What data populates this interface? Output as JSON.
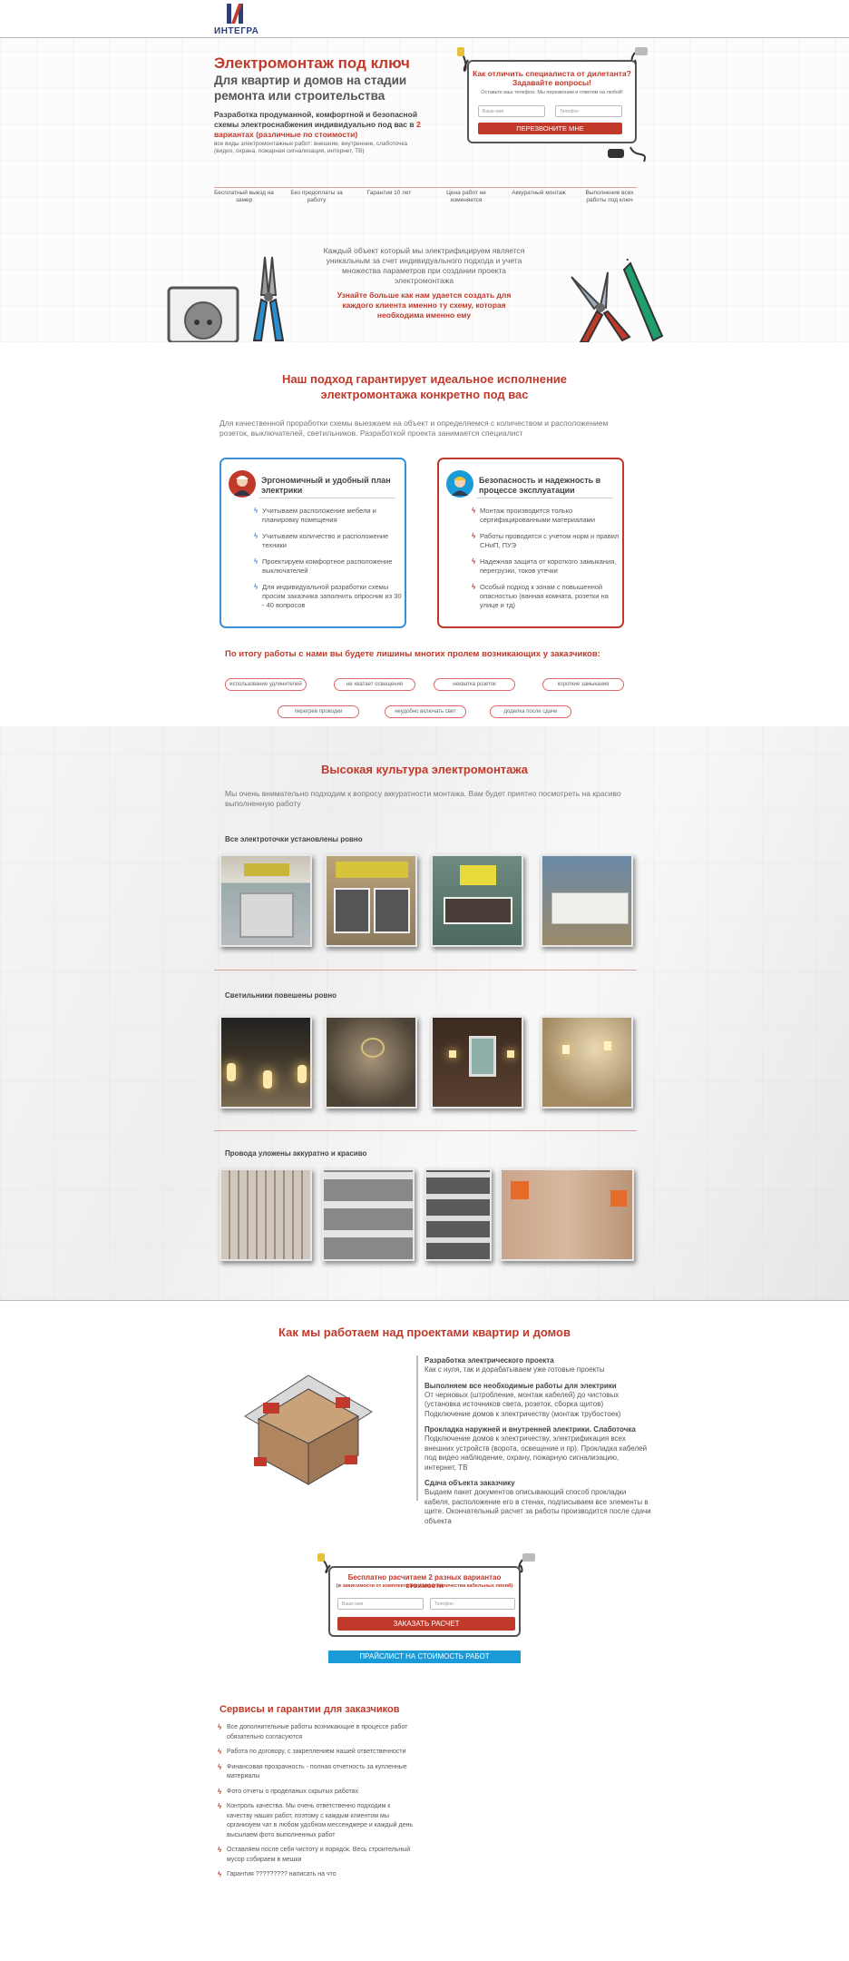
{
  "logo": {
    "text": "ИНТЕГРА"
  },
  "hero": {
    "title": "Электромонтаж под ключ",
    "subtitle": "Для квартир и домов на стадии ремонта или строительства",
    "lead_part1": "Разработка продуманной, комфортной и безопасной схемы электроснабжения индивидуально под вас в ",
    "lead_highlight": "2 вариантах (различные по стоимости)",
    "lead_small": "все виды электромонтажных работ: внешние, внутренние, слаботочка (видео, охрана, пожарная сигнализация, интернет, ТВ)"
  },
  "form1": {
    "title": "Как отличить специалиста от дилетанта? Задавайте вопросы!",
    "subtitle": "Оставьте ваш телефон. Мы перезвоним и ответим на любой!",
    "name_placeholder": "Ваше имя",
    "phone_placeholder": "Телефон",
    "button": "ПЕРЕЗВОНИТЕ МНЕ"
  },
  "features": [
    "Бесплатный выезд на замер",
    "Без предоплаты за работу",
    "Гарантия 10 лет",
    "Цена работ не изменяется",
    "Аккуратный монтаж",
    "Выполнение всех работы под ключ"
  ],
  "intro": {
    "text": "Каждый объект который мы электрифицируем является уникальным за счет индивидуального подхода и учета множества параметров при создании проекта электромонтажа",
    "red": "Узнайте больше как нам удается создать для каждого клиента именно ту схему, которая необходима именно ему"
  },
  "approach": {
    "title": "Наш подход гарантирует идеальное исполнение электромонтажа конкретно под вас",
    "text": "Для качественной проработки схемы выезжаем на объект и определяемся с количеством и расположением розеток, выключателей, светильников. Разработкой проекта занимается специалист",
    "card1": {
      "title": "Эргономичный и удобный план электрики",
      "items": [
        "Учитываем расположение мебели и планировку помещения",
        "Учитываем количество и расположение техники",
        "Проектируем комфортное расположение выключателей",
        "Для индивидуальной разработки схемы просим заказчика заполнить опросник из 30 - 40 вопросов"
      ]
    },
    "card2": {
      "title": "Безопасность и надежность в процессе эксплуатации",
      "items": [
        "Монтаж производится только сертифицированными материалами",
        "Работы проводятся с учетом норм и правил СНиП, ПУЭ",
        "Надежная защита от короткого замыкания, перегрузки, токов утечки",
        "Особый подход к зонам с повышенной опасностью (ванная комната, розетки на улице и тд)"
      ]
    }
  },
  "problems": {
    "title": "По итогу работы с нами вы будете лишины многих пролем возникающих у заказчиков:",
    "tags": [
      "использование удлинителей",
      "не хватает освещения",
      "нехватка розеток",
      "короткие замыкания",
      "перегрев проводки",
      "неудобно включать свет",
      "доделка после сдачи"
    ]
  },
  "culture": {
    "title": "Высокая культура электромонтажа",
    "text": "Мы очень внимательно подходим к вопросу аккуратности монтажа. Вам будет приятно посмотреть на красиво выполненную работу",
    "group1": "Все электроточки установлены ровно",
    "group2": "Светильники повешены ровно",
    "group3": "Провода уложены аккуратно и красиво"
  },
  "process": {
    "title": "Как мы работаем над проектами квартир и домов",
    "steps": [
      {
        "h": "Разработка электрического проекта",
        "p": "Как с нуля, так и дорабатываем уже готовые проекты"
      },
      {
        "h": "Выполняем все необходимые работы для электрики",
        "p": "От черновых (штробление, монтаж кабелей) до чистовых (установка источников света, розеток, сборка щитов) Подключение домов к электричеству (монтаж трубостоек)"
      },
      {
        "h": "Прокладка наружней и внутренней электрики. Слаботочка",
        "p": "Подключение домов к электричеству, электрификация всех внешних устройств (ворота, освещение и пр). Прокладка кабелей под видео наблюдение, охрану, пожарную сигнализацию, интернет, ТВ"
      },
      {
        "h": "Сдача объекта заказчику",
        "p": "Выдаем пакет документов описывающий способ прокладки кабеля, расположение его в стенах, подписываем все элементы в щите. Окончательный расчет за работы производится после сдачи объекта"
      }
    ]
  },
  "form2": {
    "title": "Бесплатно расчитаем 2 разных вариантао стоимости",
    "subtitle": "(в зависимости от комплектации щита и количества кабельных линий)",
    "name_placeholder": "Ваше имя",
    "phone_placeholder": "Телефон",
    "button": "ЗАКАЗАТЬ РАСЧЕТ",
    "price_button": "ПРАЙСЛИСТ НА СТОИМОСТЬ РАБОТ"
  },
  "services": {
    "title": "Сервисы и гарантии для заказчиков",
    "items": [
      "Все дополнительные работы возникающие в процессе работ обязательно согласуются",
      "Работа по договору, с закреплением нашей ответственности",
      "Финансовая прозрачность - полная отчетность за купленные материалы",
      "Фото отчеты о проделаных скрытых работах",
      "Контроль качества. Мы очень ответственно подходим к качеству наших работ, поэтому с каждым клиентом мы организуем чат в любом удобном мессенджере и каждый день высылаем фото выполненных работ",
      "Оставляем после себя чистоту и порядок. Весь строительный мусор собираем в мешки",
      "Гарантия ????????? написать на что"
    ]
  },
  "colors": {
    "accent": "#c0392b",
    "blue": "#1a9ad6",
    "card1_border": "#3b8fd6",
    "card2_border": "#c0392b"
  }
}
